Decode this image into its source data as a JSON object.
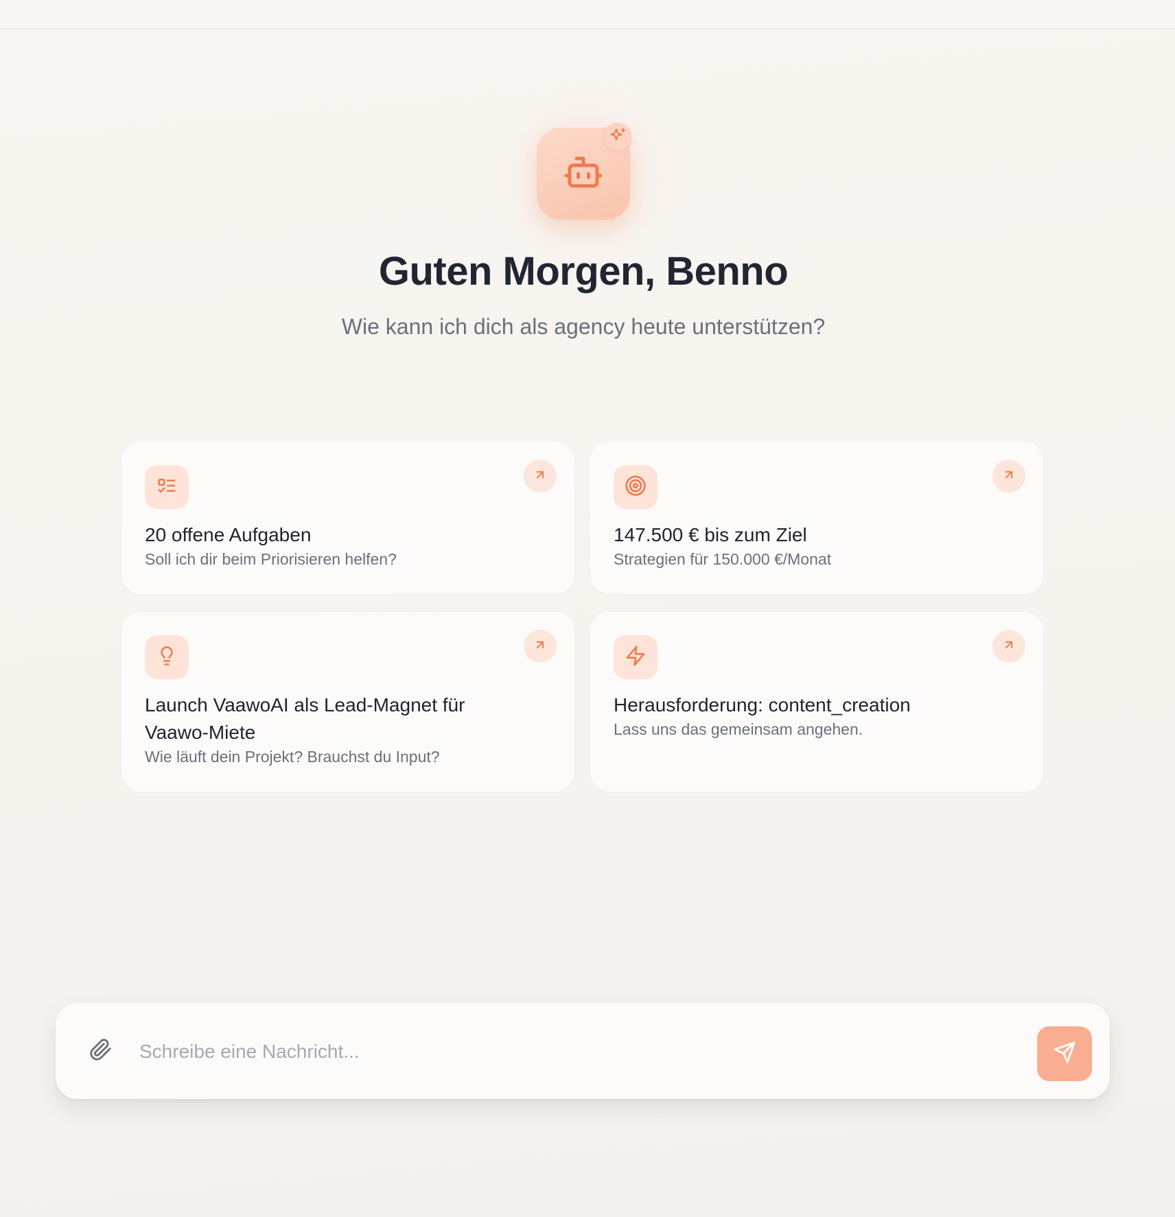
{
  "hero": {
    "avatar_icon": "robot-icon",
    "badge_icon": "sparkles-icon",
    "greeting": "Guten Morgen, Benno",
    "subtitle": "Wie kann ich dich als agency heute unterstützen?"
  },
  "cards": [
    {
      "icon": "task-list-icon",
      "title": "20 offene Aufgaben",
      "subtitle": "Soll ich dir beim Priorisieren helfen?"
    },
    {
      "icon": "target-icon",
      "title": "147.500 € bis zum Ziel",
      "subtitle": "Strategien für 150.000 €/Monat"
    },
    {
      "icon": "lightbulb-icon",
      "title": "Launch VaawoAI als Lead-Magnet für Vaawo-Miete",
      "subtitle": "Wie läuft dein Projekt? Brauchst du Input?"
    },
    {
      "icon": "lightning-icon",
      "title": "Herausforderung: content_creation",
      "subtitle": "Lass uns das gemeinsam angehen."
    }
  ],
  "composer": {
    "attach_icon": "paperclip-icon",
    "value": "",
    "placeholder": "Schreibe eine Nachricht...",
    "send_icon": "send-icon"
  },
  "colors": {
    "accent": "#ee7a50",
    "accent_soft": "#fde3d8",
    "send_button": "#f9ae91",
    "heading": "#222532",
    "muted": "#6b6f7c"
  }
}
